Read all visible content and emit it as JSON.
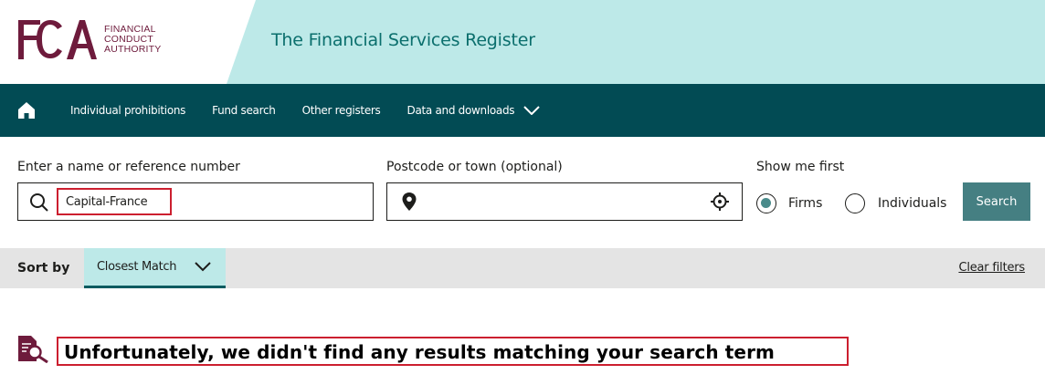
{
  "header": {
    "logo_letters": "FCA",
    "logo_lines": [
      "FINANCIAL",
      "CONDUCT",
      "AUTHORITY"
    ],
    "site_title": "The Financial Services Register"
  },
  "nav": {
    "items": [
      {
        "label": "Individual prohibitions"
      },
      {
        "label": "Fund search"
      },
      {
        "label": "Other registers"
      },
      {
        "label": "Data and downloads"
      }
    ]
  },
  "search": {
    "name_label": "Enter a name or reference number",
    "name_value": "Capital-France",
    "postcode_label": "Postcode or town (optional)",
    "postcode_value": "",
    "show_me_first_label": "Show me first",
    "options": [
      {
        "label": "Firms",
        "checked": true
      },
      {
        "label": "Individuals",
        "checked": false
      }
    ],
    "button_label": "Search"
  },
  "sort": {
    "label": "Sort by",
    "selected": "Closest Match",
    "clear_filters": "Clear filters"
  },
  "results": {
    "message": "Unfortunately, we didn't find any results matching your search term"
  },
  "colors": {
    "brand_maroon": "#6e1b3c",
    "teal_dark": "#024b54",
    "teal_light": "#bde9e8",
    "button_teal": "#457f82",
    "highlight_red": "#cc1f2f"
  }
}
